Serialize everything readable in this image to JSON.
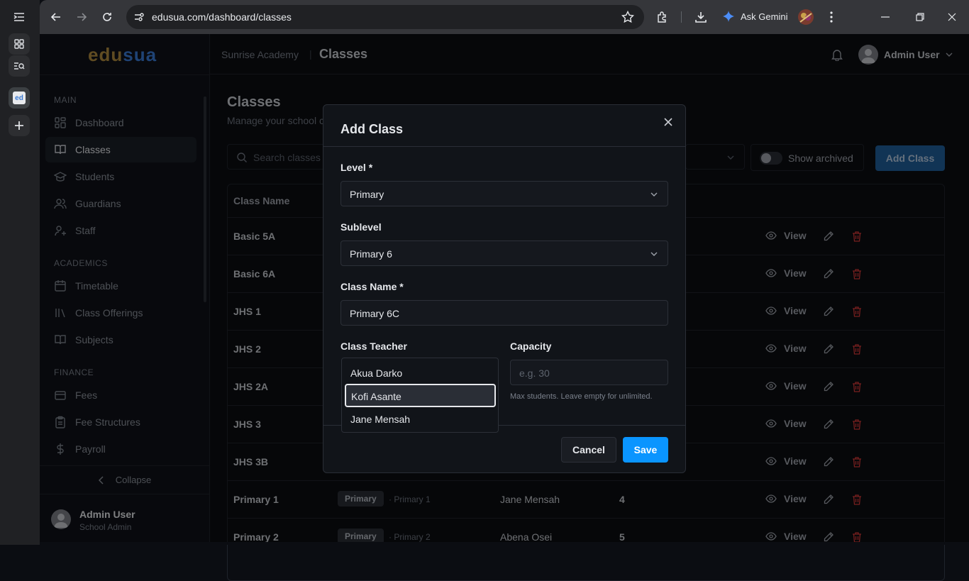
{
  "browser": {
    "url": "edusua.com/dashboard/classes",
    "ask_gemini": "Ask Gemini"
  },
  "sidebar": {
    "logo_part1": "edu",
    "logo_part2": "sua",
    "sections": {
      "main": "MAIN",
      "academics": "ACADEMICS",
      "finance": "FINANCE"
    },
    "items": [
      {
        "label": "Dashboard",
        "icon": "dashboard-icon"
      },
      {
        "label": "Classes",
        "icon": "book-icon",
        "active": true
      },
      {
        "label": "Students",
        "icon": "graduation-cap-icon"
      },
      {
        "label": "Guardians",
        "icon": "users-icon"
      },
      {
        "label": "Staff",
        "icon": "staff-icon"
      },
      {
        "label": "Timetable",
        "icon": "calendar-icon"
      },
      {
        "label": "Class Offerings",
        "icon": "library-icon"
      },
      {
        "label": "Subjects",
        "icon": "book-open-icon"
      },
      {
        "label": "Fees",
        "icon": "wallet-icon"
      },
      {
        "label": "Fee Structures",
        "icon": "clipboard-icon"
      },
      {
        "label": "Payroll",
        "icon": "dollar-icon"
      }
    ],
    "collapse": "Collapse",
    "user_name": "Admin User",
    "user_role": "School Admin"
  },
  "header": {
    "school": "Sunrise Academy",
    "separator": "|",
    "page": "Classes",
    "user": "Admin User"
  },
  "page": {
    "title": "Classes",
    "subtitle": "Manage your school c",
    "search_placeholder": "Search classes",
    "show_archived": "Show archived",
    "add_class": "Add Class"
  },
  "table": {
    "header_class_name": "Class Name",
    "view_label": "View",
    "rows": [
      {
        "name": "Basic 5A"
      },
      {
        "name": "Basic 6A"
      },
      {
        "name": "JHS 1"
      },
      {
        "name": "JHS 2"
      },
      {
        "name": "JHS 2A"
      },
      {
        "name": "JHS 3"
      },
      {
        "name": "JHS 3B"
      },
      {
        "name": "Primary 1",
        "level": "Primary",
        "sublevel": "· Primary 1",
        "teacher": "Jane Mensah",
        "count": "4"
      },
      {
        "name": "Primary 2",
        "level": "Primary",
        "sublevel": "· Primary 2",
        "teacher": "Abena Osei",
        "count": "5"
      }
    ]
  },
  "modal": {
    "title": "Add Class",
    "level_label": "Level *",
    "level_value": "Primary",
    "sublevel_label": "Sublevel",
    "sublevel_value": "Primary 6",
    "class_name_label": "Class Name *",
    "class_name_value": "Primary 6C",
    "teacher_label": "Class Teacher",
    "teacher_options": [
      "Akua Darko",
      "Kofi Asante",
      "Jane Mensah"
    ],
    "teacher_highlighted": "Kofi Asante",
    "capacity_label": "Capacity",
    "capacity_placeholder": "e.g. 30",
    "capacity_help": "Max students. Leave empty for unlimited.",
    "cancel": "Cancel",
    "save": "Save"
  },
  "colors": {
    "accent": "#0a95ff",
    "add_class_button": "#1f5f9c",
    "delete": "#d93a3a",
    "active_nav": "#1b1f27"
  }
}
